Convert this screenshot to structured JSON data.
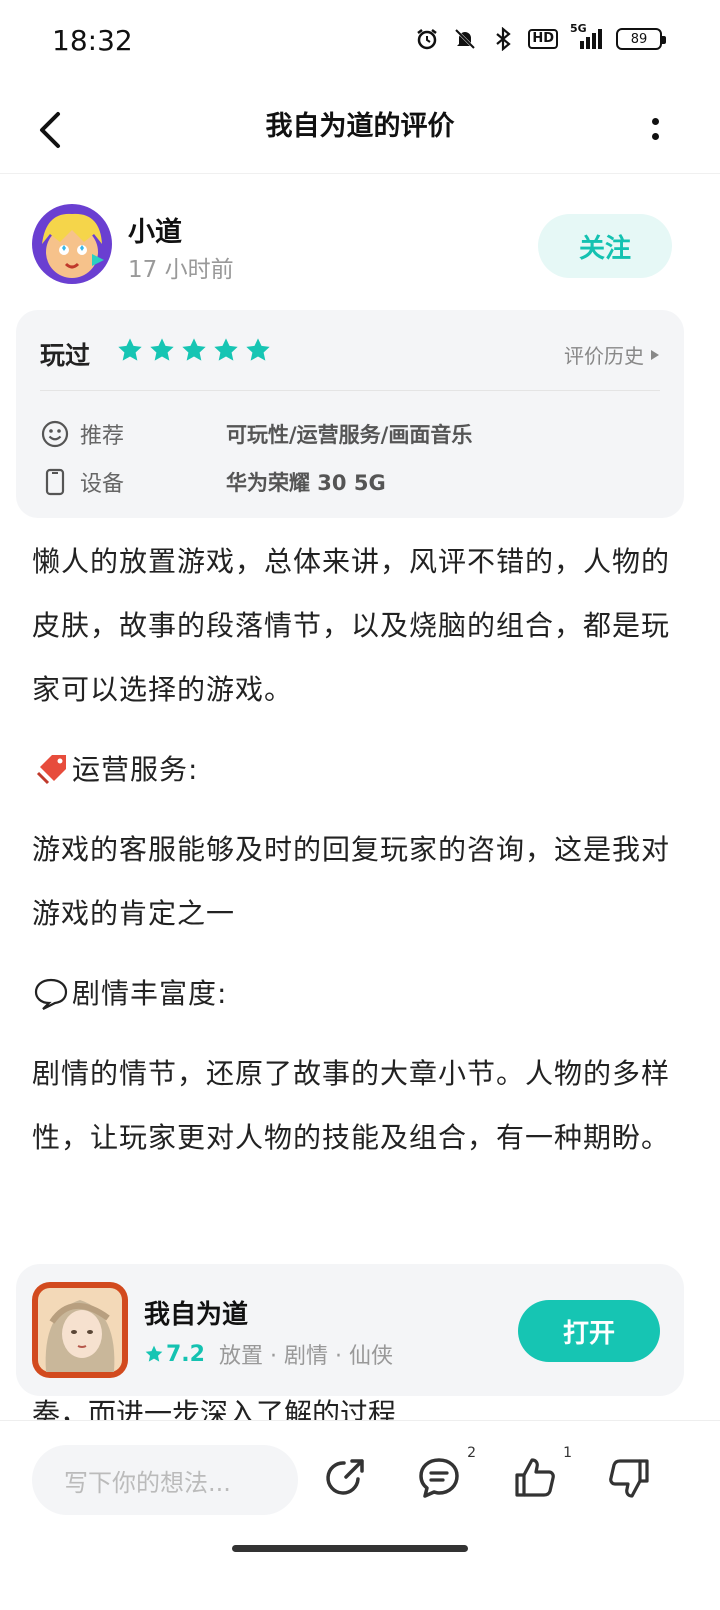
{
  "status_bar": {
    "time": "18:32",
    "hd_label": "HD",
    "network_label": "5G",
    "battery": "89"
  },
  "nav": {
    "title": "我自为道的评价"
  },
  "user": {
    "name": "小道",
    "time": "17 小时前",
    "follow_label": "关注"
  },
  "rating": {
    "status": "玩过",
    "stars": 5,
    "history_label": "评价历史",
    "recommend_key": "推荐",
    "recommend_value": "可玩性/运营服务/画面音乐",
    "device_key": "设备",
    "device_value": "华为荣耀 30 5G"
  },
  "review": {
    "p1": "懒人的放置游戏，总体来讲，风评不错的，人物的皮肤，故事的段落情节，以及烧脑的组合，都是玩家可以选择的游戏。",
    "h1": "运营服务:",
    "p2": "游戏的客服能够及时的回复玩家的咨询，这是我对游戏的肯定之一",
    "h2": "剧情丰富度:",
    "p3": "剧情的情节，还原了故事的大章小节。人物的多样性，让玩家更对人物的技能及组合，有一种期盼。",
    "peek": "奏，而进一步深入了解的过程"
  },
  "game": {
    "name": "我自为道",
    "score": "7.2",
    "tags": "放置 · 剧情 · 仙侠",
    "open_label": "打开"
  },
  "bottom_bar": {
    "placeholder": "写下你的想法...",
    "comment_count": "2",
    "like_count": "1"
  },
  "colors": {
    "accent": "#16c5b3",
    "accent_light": "#e6f8f6",
    "card_bg": "#f4f5f7"
  }
}
